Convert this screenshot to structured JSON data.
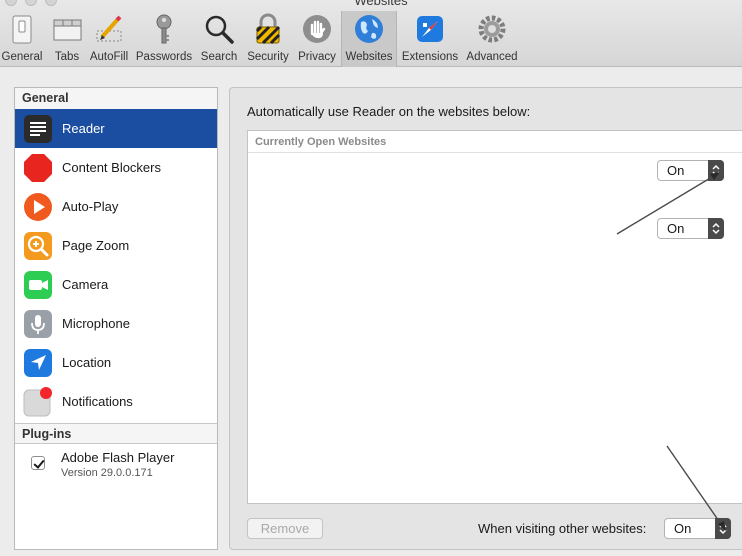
{
  "window": {
    "title": "Websites"
  },
  "toolbar": {
    "items": [
      {
        "label": "General"
      },
      {
        "label": "Tabs"
      },
      {
        "label": "AutoFill"
      },
      {
        "label": "Passwords"
      },
      {
        "label": "Search"
      },
      {
        "label": "Security"
      },
      {
        "label": "Privacy"
      },
      {
        "label": "Websites"
      },
      {
        "label": "Extensions"
      },
      {
        "label": "Advanced"
      }
    ],
    "active": "Websites"
  },
  "sidebar": {
    "general_heading": "General",
    "items": [
      {
        "label": "Reader",
        "icon": "reader-icon",
        "selected": true
      },
      {
        "label": "Content Blockers",
        "icon": "content-blockers-icon"
      },
      {
        "label": "Auto-Play",
        "icon": "auto-play-icon"
      },
      {
        "label": "Page Zoom",
        "icon": "page-zoom-icon"
      },
      {
        "label": "Camera",
        "icon": "camera-icon"
      },
      {
        "label": "Microphone",
        "icon": "microphone-icon"
      },
      {
        "label": "Location",
        "icon": "location-icon"
      },
      {
        "label": "Notifications",
        "icon": "notifications-icon"
      }
    ],
    "plugins_heading": "Plug-ins",
    "plugins": [
      {
        "name": "Adobe Flash Player",
        "version": "Version 29.0.0.171",
        "checked": true
      }
    ]
  },
  "main": {
    "intro": "Automatically use Reader on the websites below:",
    "list_header": "Currently Open Websites",
    "site_settings": [
      "On",
      "On"
    ],
    "remove_label": "Remove",
    "other_label": "When visiting other websites:",
    "other_value": "On"
  },
  "colors": {
    "selection": "#1b4ea0",
    "background": "#ececec"
  }
}
